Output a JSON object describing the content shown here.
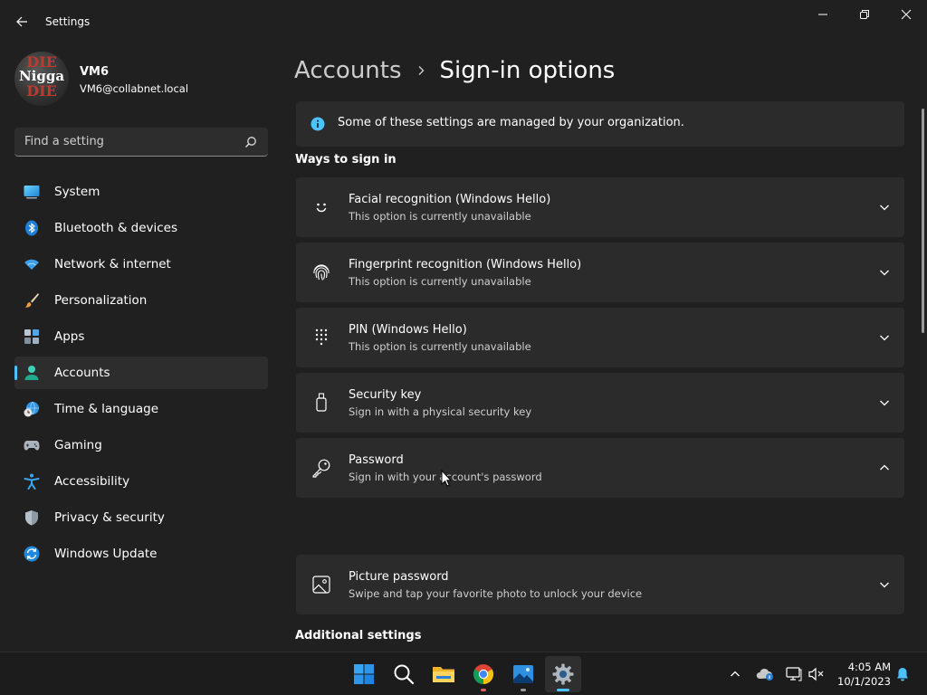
{
  "window": {
    "title": "Settings",
    "back_icon": "arrow-left-icon",
    "controls": [
      "minimize-icon",
      "restore-icon",
      "close-icon"
    ]
  },
  "profile": {
    "name": "VM6",
    "email": "VM6@collabnet.local",
    "avatar_lines": [
      "DIE",
      "Nigga",
      "DIE"
    ]
  },
  "search": {
    "placeholder": "Find a setting",
    "icon": "search-icon"
  },
  "nav": {
    "items": [
      {
        "label": "System",
        "icon": "monitor-icon"
      },
      {
        "label": "Bluetooth & devices",
        "icon": "bluetooth-icon"
      },
      {
        "label": "Network & internet",
        "icon": "wifi-icon"
      },
      {
        "label": "Personalization",
        "icon": "brush-icon"
      },
      {
        "label": "Apps",
        "icon": "apps-icon"
      },
      {
        "label": "Accounts",
        "icon": "person-icon",
        "selected": true
      },
      {
        "label": "Time & language",
        "icon": "globe-clock-icon"
      },
      {
        "label": "Gaming",
        "icon": "gamepad-icon"
      },
      {
        "label": "Accessibility",
        "icon": "accessibility-icon"
      },
      {
        "label": "Privacy & security",
        "icon": "shield-icon"
      },
      {
        "label": "Windows Update",
        "icon": "update-icon"
      }
    ]
  },
  "breadcrumb": {
    "parent": "Accounts",
    "current": "Sign-in options"
  },
  "info": {
    "text": "Some of these settings are managed by your organization.",
    "icon": "info-icon"
  },
  "sections": {
    "ways_title": "Ways to sign in",
    "additional_title": "Additional settings"
  },
  "options": [
    {
      "title": "Facial recognition (Windows Hello)",
      "subtitle": "This option is currently unavailable",
      "icon": "face-icon",
      "expanded": false
    },
    {
      "title": "Fingerprint recognition (Windows Hello)",
      "subtitle": "This option is currently unavailable",
      "icon": "fingerprint-icon",
      "expanded": false
    },
    {
      "title": "PIN (Windows Hello)",
      "subtitle": "This option is currently unavailable",
      "icon": "keypad-icon",
      "expanded": false
    },
    {
      "title": "Security key",
      "subtitle": "Sign in with a physical security key",
      "icon": "usb-key-icon",
      "expanded": false
    },
    {
      "title": "Password",
      "subtitle": "Sign in with your account's password",
      "icon": "key-icon",
      "expanded": true
    },
    {
      "title": "Picture password",
      "subtitle": "Swipe and tap your favorite photo to unlock your device",
      "icon": "picture-icon",
      "expanded": false
    }
  ],
  "taskbar": {
    "apps": [
      {
        "name": "Start",
        "icon": "windows-start-icon"
      },
      {
        "name": "Search",
        "icon": "search-icon"
      },
      {
        "name": "File Explorer",
        "icon": "folder-icon"
      },
      {
        "name": "Google Chrome",
        "icon": "chrome-icon",
        "running": true
      },
      {
        "name": "Photos",
        "icon": "photos-icon",
        "running": true
      },
      {
        "name": "Settings",
        "icon": "gear-icon",
        "running": true,
        "active": true
      }
    ],
    "tray": [
      "chevron-up-icon",
      "onedrive-icon",
      "network-icon",
      "speaker-muted-icon"
    ],
    "time": "4:05 AM",
    "date": "10/1/2023",
    "notification_icon": "bell-icon"
  },
  "colors": {
    "background": "#202020",
    "card": "#2b2b2b",
    "accent": "#4cc2ff"
  }
}
